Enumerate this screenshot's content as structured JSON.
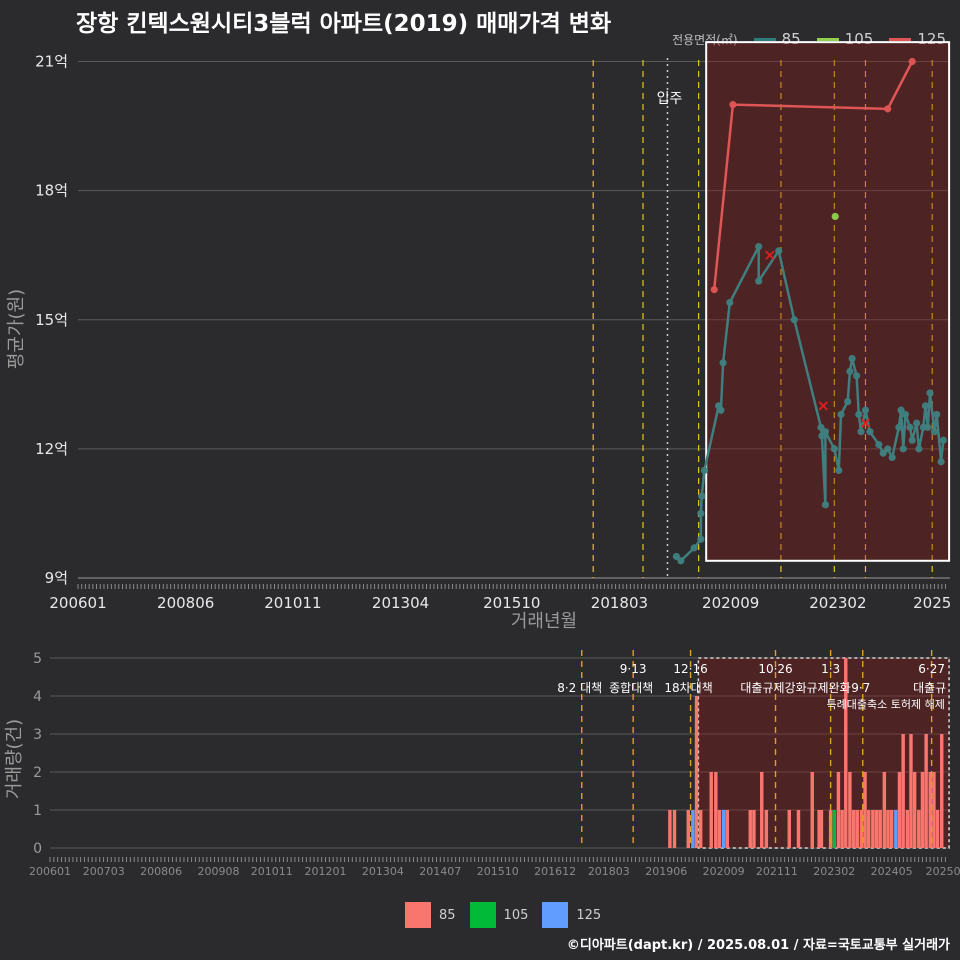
{
  "title": "장항 킨텍스원시티3블럭 아파트(2019) 매매가격 변화",
  "legend": {
    "title": "전용면적(㎡)",
    "items": [
      {
        "label": "85",
        "color": "#2e7d7d"
      },
      {
        "label": "105",
        "color": "#8fd14f"
      },
      {
        "label": "125",
        "color": "#e05555"
      }
    ]
  },
  "bottom_legend": {
    "items": [
      {
        "label": "85",
        "color": "#f8766d"
      },
      {
        "label": "105",
        "color": "#00ba38"
      },
      {
        "label": "125",
        "color": "#619cff"
      }
    ]
  },
  "source": "©디아파트(dapt.kr) / 2025.08.01 / 자료=국토교통부 실거래가",
  "chart_data": [
    {
      "type": "line",
      "xlabel": "거래년월",
      "ylabel": "평균가(원)",
      "xlim": [
        2006.0,
        2025.6
      ],
      "ylim": [
        9,
        21.5
      ],
      "grid": true,
      "y_ticks": [
        {
          "value": 9,
          "label": "9억"
        },
        {
          "value": 12,
          "label": "12억"
        },
        {
          "value": 15,
          "label": "15억"
        },
        {
          "value": 18,
          "label": "18억"
        },
        {
          "value": 21,
          "label": "21억"
        }
      ],
      "x_ticks": [
        {
          "value": 2006.0,
          "label": "200601"
        },
        {
          "value": 2008.42,
          "label": "200806"
        },
        {
          "value": 2010.83,
          "label": "201011"
        },
        {
          "value": 2013.25,
          "label": "201304"
        },
        {
          "value": 2015.75,
          "label": "201510"
        },
        {
          "value": 2018.17,
          "label": "201803"
        },
        {
          "value": 2020.67,
          "label": "202009"
        },
        {
          "value": 2023.08,
          "label": "202302"
        },
        {
          "value": 2025.2,
          "label": "2025"
        }
      ],
      "annotation": {
        "label": "입주",
        "x": 2019.25
      },
      "series": [
        {
          "name": "85",
          "color": "#3f7f7f",
          "points": [
            [
              2019.45,
              9.5
            ],
            [
              2019.55,
              9.4
            ],
            [
              2019.85,
              9.7
            ],
            [
              2020.0,
              9.9
            ],
            [
              2020.0,
              10.5
            ],
            [
              2020.02,
              10.9
            ],
            [
              2020.08,
              11.5
            ],
            [
              2020.4,
              13.0
            ],
            [
              2020.45,
              12.9
            ],
            [
              2020.5,
              14.0
            ],
            [
              2020.65,
              15.4
            ],
            [
              2021.3,
              16.7
            ],
            [
              2021.3,
              15.9
            ],
            [
              2021.75,
              16.6
            ],
            [
              2022.1,
              15.0
            ],
            [
              2022.8,
              10.7
            ],
            [
              2022.7,
              12.5
            ],
            [
              2022.72,
              12.3
            ],
            [
              2022.8,
              12.4
            ],
            [
              2023.0,
              12.0
            ],
            [
              2023.1,
              11.5
            ],
            [
              2023.15,
              12.8
            ],
            [
              2023.3,
              13.1
            ],
            [
              2023.35,
              13.8
            ],
            [
              2023.4,
              14.1
            ],
            [
              2023.5,
              13.7
            ],
            [
              2023.55,
              12.8
            ],
            [
              2023.6,
              12.4
            ],
            [
              2023.7,
              12.9
            ],
            [
              2023.8,
              12.4
            ],
            [
              2024.0,
              12.1
            ],
            [
              2024.1,
              11.9
            ],
            [
              2024.2,
              12.0
            ],
            [
              2024.3,
              11.8
            ],
            [
              2024.45,
              12.5
            ],
            [
              2024.5,
              12.9
            ],
            [
              2024.55,
              12.0
            ],
            [
              2024.6,
              12.8
            ],
            [
              2024.7,
              12.5
            ],
            [
              2024.75,
              12.2
            ],
            [
              2024.85,
              12.6
            ],
            [
              2024.9,
              12.0
            ],
            [
              2025.0,
              12.5
            ],
            [
              2025.05,
              13.0
            ],
            [
              2025.1,
              12.5
            ],
            [
              2025.15,
              13.3
            ],
            [
              2025.25,
              12.4
            ],
            [
              2025.3,
              12.8
            ],
            [
              2025.4,
              11.7
            ],
            [
              2025.45,
              12.2
            ]
          ]
        },
        {
          "name": "105",
          "color": "#8fd14f",
          "points": [
            [
              2023.02,
              17.4
            ]
          ]
        },
        {
          "name": "125",
          "color": "#e05555",
          "points": [
            [
              2020.3,
              15.7
            ],
            [
              2020.72,
              20.0
            ],
            [
              2024.2,
              19.9
            ],
            [
              2024.75,
              21.0
            ]
          ]
        }
      ],
      "cancelled": [
        [
          2021.55,
          16.5
        ],
        [
          2022.75,
          13.0
        ],
        [
          2023.7,
          12.6
        ]
      ]
    },
    {
      "type": "bar",
      "ylabel": "거래량(건)",
      "xlim": [
        2006.0,
        2025.6
      ],
      "ylim": [
        0,
        5
      ],
      "y_ticks": [
        0,
        1,
        2,
        3,
        4,
        5
      ],
      "x_ticks": [
        {
          "value": 2006.0,
          "label": "200601"
        },
        {
          "value": 2007.17,
          "label": "200703"
        },
        {
          "value": 2008.42,
          "label": "200806"
        },
        {
          "value": 2009.67,
          "label": "200908"
        },
        {
          "value": 2010.83,
          "label": "201011"
        },
        {
          "value": 2012.0,
          "label": "201201"
        },
        {
          "value": 2013.25,
          "label": "201304"
        },
        {
          "value": 2014.5,
          "label": "201407"
        },
        {
          "value": 2015.75,
          "label": "201510"
        },
        {
          "value": 2017.0,
          "label": "201612"
        },
        {
          "value": 2018.17,
          "label": "201803"
        },
        {
          "value": 2019.42,
          "label": "201906"
        },
        {
          "value": 2020.67,
          "label": "202009"
        },
        {
          "value": 2021.83,
          "label": "202111"
        },
        {
          "value": 2023.08,
          "label": "202302"
        },
        {
          "value": 2024.33,
          "label": "202405"
        },
        {
          "value": 2025.45,
          "label": "20250"
        }
      ],
      "policies": [
        {
          "x": 2017.58,
          "top": "",
          "bottom": "8·2 대책"
        },
        {
          "x": 2018.7,
          "top": "9·13",
          "bottom": "종합대책"
        },
        {
          "x": 2019.95,
          "top": "12·16",
          "bottom": "18차대책"
        },
        {
          "x": 2021.8,
          "top": "10·26",
          "bottom": "대출규제강화"
        },
        {
          "x": 2023.0,
          "top": "1·3",
          "bottom": "규제완화"
        },
        {
          "x": 2023.7,
          "top": "",
          "bottom": "9·7"
        },
        {
          "x": 2025.2,
          "top": "6·27",
          "bottom": "대출규"
        }
      ],
      "policy_notes": [
        "특례대출축소 토허제 해제"
      ],
      "bars": [
        {
          "x": 2019.5,
          "series": "85",
          "value": 1
        },
        {
          "x": 2019.6,
          "series": "85",
          "value": 1
        },
        {
          "x": 2019.9,
          "series": "85",
          "value": 1
        },
        {
          "x": 2020.0,
          "series": "125",
          "value": 1
        },
        {
          "x": 2020.08,
          "series": "85",
          "value": 4
        },
        {
          "x": 2020.17,
          "series": "85",
          "value": 1
        },
        {
          "x": 2020.4,
          "series": "85",
          "value": 2
        },
        {
          "x": 2020.5,
          "series": "85",
          "value": 2
        },
        {
          "x": 2020.58,
          "series": "85",
          "value": 1
        },
        {
          "x": 2020.67,
          "series": "125",
          "value": 1
        },
        {
          "x": 2020.75,
          "series": "85",
          "value": 1
        },
        {
          "x": 2021.25,
          "series": "85",
          "value": 1
        },
        {
          "x": 2021.33,
          "series": "85",
          "value": 1
        },
        {
          "x": 2021.5,
          "series": "85",
          "value": 2
        },
        {
          "x": 2021.6,
          "series": "85",
          "value": 1
        },
        {
          "x": 2022.1,
          "series": "85",
          "value": 1
        },
        {
          "x": 2022.3,
          "series": "85",
          "value": 1
        },
        {
          "x": 2022.6,
          "series": "85",
          "value": 2
        },
        {
          "x": 2022.75,
          "series": "85",
          "value": 1
        },
        {
          "x": 2022.8,
          "series": "85",
          "value": 1
        },
        {
          "x": 2023.0,
          "series": "85",
          "value": 1
        },
        {
          "x": 2023.08,
          "series": "105",
          "value": 1
        },
        {
          "x": 2023.17,
          "series": "85",
          "value": 2
        },
        {
          "x": 2023.25,
          "series": "85",
          "value": 1
        },
        {
          "x": 2023.33,
          "series": "85",
          "value": 5
        },
        {
          "x": 2023.42,
          "series": "85",
          "value": 2
        },
        {
          "x": 2023.5,
          "series": "85",
          "value": 1
        },
        {
          "x": 2023.58,
          "series": "85",
          "value": 1
        },
        {
          "x": 2023.67,
          "series": "85",
          "value": 1
        },
        {
          "x": 2023.75,
          "series": "85",
          "value": 2
        },
        {
          "x": 2023.83,
          "series": "85",
          "value": 1
        },
        {
          "x": 2023.92,
          "series": "85",
          "value": 1
        },
        {
          "x": 2024.0,
          "series": "85",
          "value": 1
        },
        {
          "x": 2024.08,
          "series": "85",
          "value": 1
        },
        {
          "x": 2024.17,
          "series": "85",
          "value": 2
        },
        {
          "x": 2024.25,
          "series": "85",
          "value": 1
        },
        {
          "x": 2024.33,
          "series": "85",
          "value": 1
        },
        {
          "x": 2024.42,
          "series": "125",
          "value": 1
        },
        {
          "x": 2024.5,
          "series": "85",
          "value": 2
        },
        {
          "x": 2024.58,
          "series": "85",
          "value": 3
        },
        {
          "x": 2024.67,
          "series": "85",
          "value": 1
        },
        {
          "x": 2024.75,
          "series": "85",
          "value": 3
        },
        {
          "x": 2024.83,
          "series": "85",
          "value": 2
        },
        {
          "x": 2024.92,
          "series": "85",
          "value": 1
        },
        {
          "x": 2025.0,
          "series": "85",
          "value": 2
        },
        {
          "x": 2025.08,
          "series": "85",
          "value": 3
        },
        {
          "x": 2025.17,
          "series": "85",
          "value": 2
        },
        {
          "x": 2025.25,
          "series": "85",
          "value": 2
        },
        {
          "x": 2025.33,
          "series": "85",
          "value": 1
        },
        {
          "x": 2025.42,
          "series": "85",
          "value": 3
        }
      ]
    }
  ]
}
